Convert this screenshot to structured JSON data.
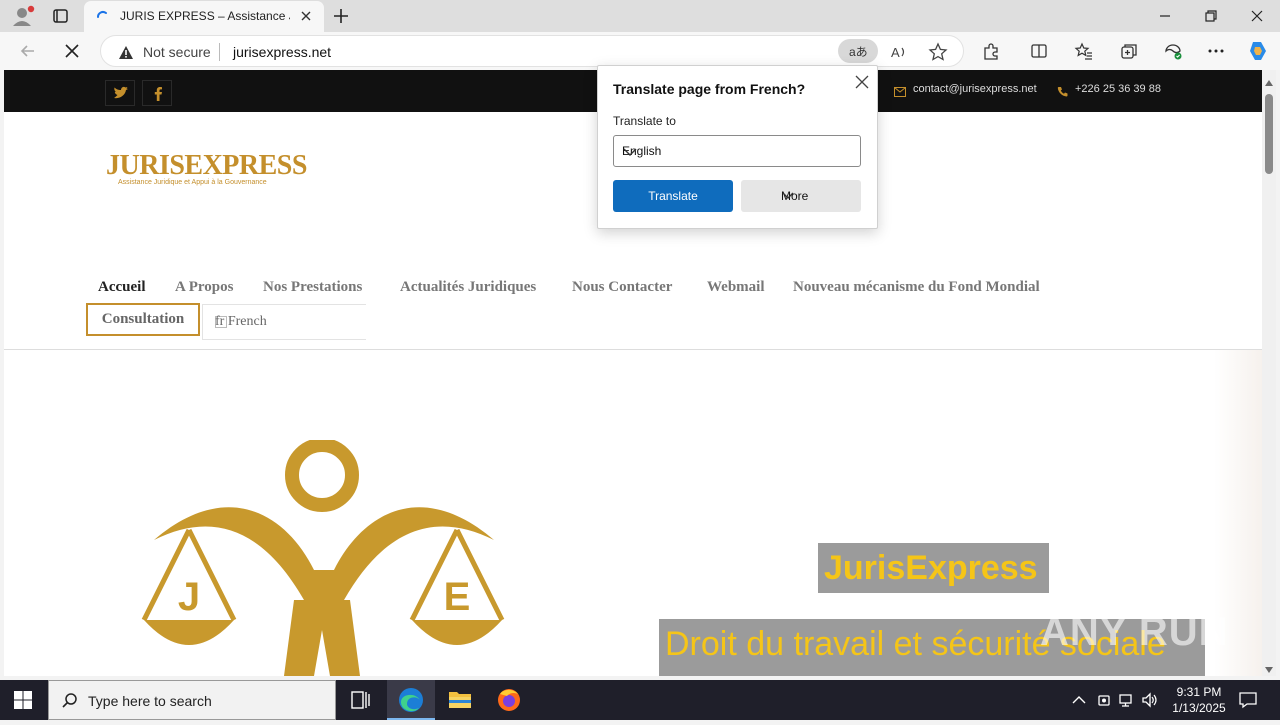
{
  "browser": {
    "tab_title": "JURIS EXPRESS – Assistance Juridique",
    "security_label": "Not secure",
    "url": "jurisexpress.net",
    "translate_pill_glyph": "aあ"
  },
  "site": {
    "topbar": {
      "email": "contact@jurisexpress.net",
      "phone": "+226 25 36 39 88"
    },
    "logo": {
      "name": "JURISEXPRESS",
      "tagline": "Assistance Juridique et Appui à la Gouvernance"
    },
    "menu": [
      {
        "label": "Accueil",
        "active": true
      },
      {
        "label": "A Propos"
      },
      {
        "label": "Nos Prestations"
      },
      {
        "label": "Actualités Juridiques"
      },
      {
        "label": "Nous Contacter"
      },
      {
        "label": "Webmail"
      },
      {
        "label": "Nouveau mécanisme du Fond Mondial"
      }
    ],
    "consultation": "Consultation",
    "language": "fr French",
    "hero": {
      "emblem_left": "J",
      "emblem_right": "E",
      "title": "JurisExpress",
      "subtitle": "Droit du travail et sécurité sociale"
    },
    "watermark": "ANY RUN"
  },
  "translate_popup": {
    "title": "Translate page from French?",
    "label": "Translate to",
    "selected_language": "English",
    "translate_button": "Translate",
    "more_button": "More"
  },
  "taskbar": {
    "search_placeholder": "Type here to search",
    "time": "9:31 PM",
    "date": "1/13/2025"
  },
  "colors": {
    "brand_gold": "#c48f2c",
    "hero_yellow": "#f5c518",
    "primary_blue": "#0f6cbd"
  }
}
